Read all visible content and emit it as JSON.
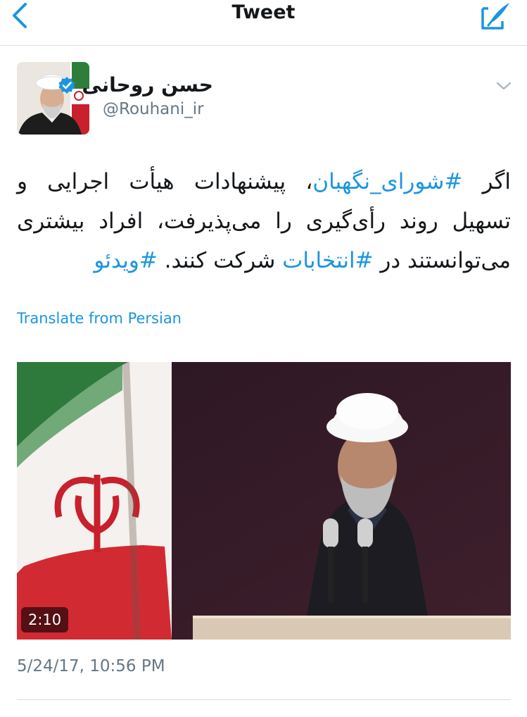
{
  "navbar": {
    "title": "Tweet",
    "back_icon": "chevron-left-icon",
    "compose_icon": "compose-tweet-icon"
  },
  "tweet": {
    "author": {
      "display_name": "حسن روحانی",
      "handle": "@Rouhani_ir",
      "verified": true
    },
    "text_parts": {
      "p1": "اگر ",
      "hashtag_guardian": "#شورای_نگهبان",
      "p2": "، پیشنهادات هیأت اجرایی و تسهیل روند رأی‌گیری را می‌پذیرفت، افراد بیشتری می‌توانستند در ",
      "hashtag_elections": "#انتخابات",
      "p3": " شرکت کنند. ",
      "hashtag_video": "#ویدئو"
    },
    "translate_label": "Translate from Persian",
    "media": {
      "type": "video",
      "duration": "2:10"
    },
    "timestamp": "5/24/17, 10:56 PM"
  },
  "colors": {
    "link": "#1b95e0",
    "secondary_text": "#657786",
    "primary_text": "#14171a",
    "divider": "#d8dde2"
  }
}
